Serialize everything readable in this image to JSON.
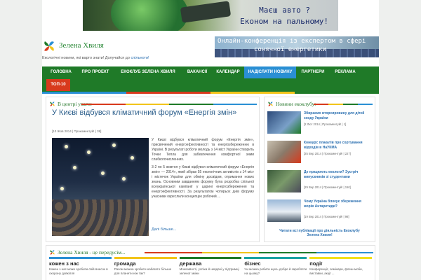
{
  "top_banner": {
    "line1": "Маєш авто ?",
    "line2": "Економ на пальному!"
  },
  "site": {
    "title": "Зелена Хвиля",
    "tagline_prefix": "Екологічні новини, які варто знати! Долучайся до",
    "tagline_link": "спільноти!"
  },
  "side_banner": {
    "line1": "Онлайн-конференція із експертом в сфері",
    "line2": "сонячної енергетики"
  },
  "nav": {
    "items": [
      {
        "label": "ГОЛОВНА"
      },
      {
        "label": "ПРО ПРОЕКТ"
      },
      {
        "label": "ЕКОКЛУБ ЗЕЛЕНА ХВИЛЯ"
      },
      {
        "label": "ВАКАНСІЇ"
      },
      {
        "label": "КАЛЕНДАР"
      },
      {
        "label": "НАДІСЛАТИ НОВИНУ"
      },
      {
        "label": "ПАРТНЕРИ"
      },
      {
        "label": "РЕКЛАМА"
      },
      {
        "label": "ТОП-10"
      }
    ],
    "active_color": "#2a8fd4",
    "hot_color": "#d83a1c"
  },
  "colors": {
    "green": "#1f7a28",
    "blue": "#2a8fd4",
    "red": "#d83a1c",
    "yellow": "#f2c41a",
    "teal": "#1aa3a3"
  },
  "featured": {
    "heading": "В центрі уваги:",
    "title": "У Києві відбувся кліматичний форум «Енергія змін»",
    "meta": "[10 Жов 2014 | Прокоментуй! | 38]",
    "paragraph1": "У Києві відбувся кліматичний форум «Енергія змін», присвячений енергоефективності та енергозбереженню в Україні. В результаті роботи молодь з 14 міст України створить Точки Тепла для забезпечення комфортної зими слабкогочисленних.",
    "paragraph2": "3-2 по 5 жовтня у Києві відбувся кліматичний форум «Енергія змін» — 2014», який зібрав 55 екологічних активістів з 14 міст і містечок України для обміну досвідом, отримання нових знань. Основним завданням форуму була розробка спільної всеукраїнської кампанії у царині енергозбереження та енергоефективності. За результатом чотирьох днів форуму учасники окреслили концепцію робочий ...",
    "more": "Далі більше..."
  },
  "eco_news": {
    "heading": "Новини екоклубу:",
    "items": [
      {
        "title": "Збираємо вторсировину для дітей сходу України",
        "meta": "[2 Лют 2014 | Прокоментуй! | 1]"
      },
      {
        "title": "Конкурс плакатів про сортування відходів в НаУКМА",
        "meta": "[25 Вер 2014 | Прокоментуй! | 227]"
      },
      {
        "title": "Де працюють екологи? Зустріч випускників зі студентами",
        "meta": "[29 Вер 2014 | Прокоментуй! | 150]"
      },
      {
        "title": "Чому Україна блокує збереження морів Антарктиди?",
        "meta": "[19 Вер 2014 | Прокоментуй! | 98]"
      }
    ],
    "footer_link": "Читати всі публікації про діяльність Екоклубу Зелена Хвиля!"
  },
  "bottom": {
    "heading": "Зелена Хвиля - це передусім...",
    "columns": [
      {
        "title": "кожен з нас",
        "desc": "Кожен з нас може зробити свій внесок в охорону довкілля"
      },
      {
        "title": "громада",
        "desc": "Разом можна зробити набагато більше для планети ніж так?"
      },
      {
        "title": "держава",
        "desc": "Можливості, успіхи й невдачі у підтримці зеленої зміни"
      },
      {
        "title": "бізнес",
        "desc": "Чи можна робити щось добре й заробляти на цьому?"
      },
      {
        "title": "події",
        "desc": "Конференції, семінари, флеш-моби, виставки, акції ..."
      }
    ]
  }
}
